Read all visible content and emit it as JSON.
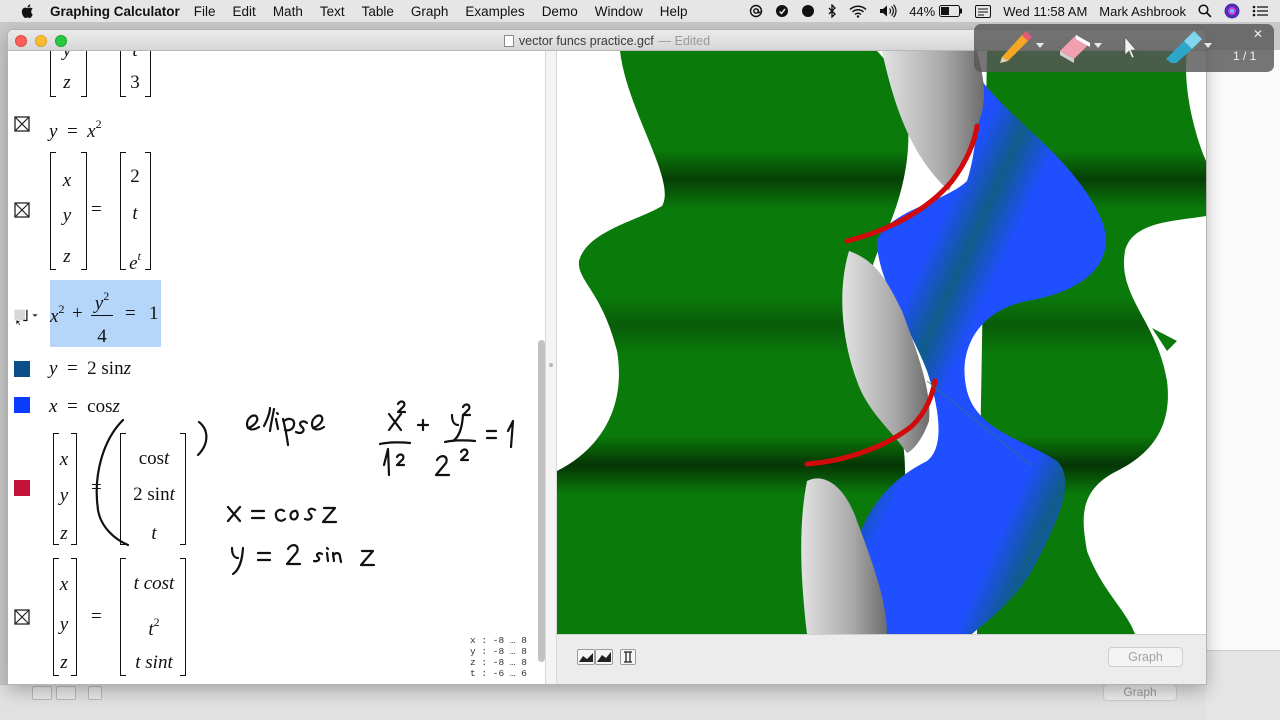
{
  "menubar": {
    "app_name": "Graphing Calculator",
    "items": [
      "File",
      "Edit",
      "Math",
      "Text",
      "Table",
      "Graph",
      "Examples",
      "Demo",
      "Window",
      "Help"
    ],
    "battery": "44%",
    "clock": "Wed 11:58 AM",
    "user": "Mark Ashbrook"
  },
  "window": {
    "title": "vector funcs practice.gcf",
    "edited": "— Edited"
  },
  "equations": {
    "partial_matrix": {
      "rows": [
        "z"
      ],
      "values": [
        "3"
      ]
    },
    "eq1": {
      "lhs": "y",
      "rhs": "x",
      "exp": "2"
    },
    "eq2": {
      "rows": [
        "x",
        "y",
        "z"
      ],
      "values": [
        "2",
        "t",
        "e"
      ],
      "exp": "t"
    },
    "eq3": {
      "x2": "x",
      "exp": "2",
      "plus": "+",
      "num": "y",
      "den": "4",
      "rhs": "1"
    },
    "eq4": {
      "lhs": "y",
      "rhs": "2 sin",
      "var": "z"
    },
    "eq5": {
      "lhs": "x",
      "rhs": "cos",
      "var": "z"
    },
    "eq6": {
      "rows": [
        "x",
        "y",
        "z"
      ],
      "values": [
        "cos",
        "2 sin",
        "t"
      ],
      "var": "t"
    },
    "eq7": {
      "rows": [
        "x",
        "y",
        "z"
      ],
      "values": [
        "t cos",
        "t",
        "t sin"
      ],
      "var": "t",
      "exp": "2"
    },
    "equals": "="
  },
  "colors": {
    "eq4_swatch": "#0b4f8a",
    "eq5_swatch": "#0a3cff",
    "eq6_swatch": "#c4123a",
    "surface_green": "#0a7a0a",
    "surface_blue": "#1f4fff",
    "surface_gray": "#b8b8b8",
    "curve_red": "#d10b0b"
  },
  "ranges": {
    "x": "x :  -8  …  8",
    "y": "y :  -8  …  8",
    "z": "z :  -8  …  8",
    "t": "t :  -6  …  6"
  },
  "graph": {
    "button": "Graph",
    "bg_button": "Graph"
  },
  "annotation": {
    "page": "1 / 1"
  }
}
